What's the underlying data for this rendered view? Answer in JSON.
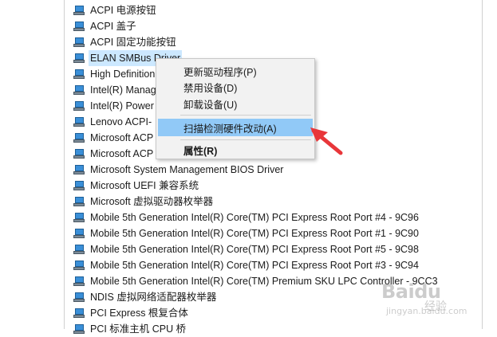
{
  "devices": [
    {
      "label": "ACPI 电源按钮",
      "icon": "device-icon"
    },
    {
      "label": "ACPI 盖子",
      "icon": "device-icon"
    },
    {
      "label": "ACPI 固定功能按钮",
      "icon": "device-icon"
    },
    {
      "label": "ELAN SMBus Driver",
      "icon": "device-icon",
      "selected": true
    },
    {
      "label": "High Definition",
      "icon": "device-icon"
    },
    {
      "label": "Intel(R) Manag",
      "icon": "device-icon"
    },
    {
      "label": "Intel(R) Power",
      "icon": "device-icon"
    },
    {
      "label": "Lenovo ACPI-",
      "icon": "device-icon"
    },
    {
      "label": "Microsoft ACP",
      "icon": "device-icon"
    },
    {
      "label": "Microsoft ACP",
      "icon": "device-icon"
    },
    {
      "label": "Microsoft System Management BIOS Driver",
      "icon": "device-icon"
    },
    {
      "label": "Microsoft UEFI 兼容系统",
      "icon": "device-icon"
    },
    {
      "label": "Microsoft 虚拟驱动器枚举器",
      "icon": "device-icon"
    },
    {
      "label": "Mobile 5th Generation Intel(R) Core(TM) PCI Express Root Port #4 - 9C96",
      "icon": "device-icon"
    },
    {
      "label": "Mobile 5th Generation Intel(R) Core(TM) PCI Express Root Port #1 - 9C90",
      "icon": "device-icon"
    },
    {
      "label": "Mobile 5th Generation Intel(R) Core(TM) PCI Express Root Port #5 - 9C98",
      "icon": "device-icon"
    },
    {
      "label": "Mobile 5th Generation Intel(R) Core(TM) PCI Express Root Port #3 - 9C94",
      "icon": "device-icon"
    },
    {
      "label": "Mobile 5th Generation Intel(R) Core(TM) Premium SKU LPC Controller - 9CC3",
      "icon": "device-icon"
    },
    {
      "label": "NDIS 虚拟网络适配器枚举器",
      "icon": "device-icon"
    },
    {
      "label": "PCI Express 根复合体",
      "icon": "device-icon"
    },
    {
      "label": "PCI 标准主机 CPU 桥",
      "icon": "device-icon"
    }
  ],
  "context_menu": {
    "items": [
      {
        "label": "更新驱动程序(P)"
      },
      {
        "label": "禁用设备(D)"
      },
      {
        "label": "卸载设备(U)"
      },
      {
        "label": "扫描检测硬件改动(A)",
        "highlighted": true
      },
      {
        "label": "属性(R)",
        "bold": true
      }
    ]
  },
  "annotation": {
    "icon": "red-arrow-icon",
    "color": "#e8363a"
  },
  "watermark": {
    "brand": "Baidu",
    "sub": "经验",
    "url": "jingyan.baidu.com"
  }
}
